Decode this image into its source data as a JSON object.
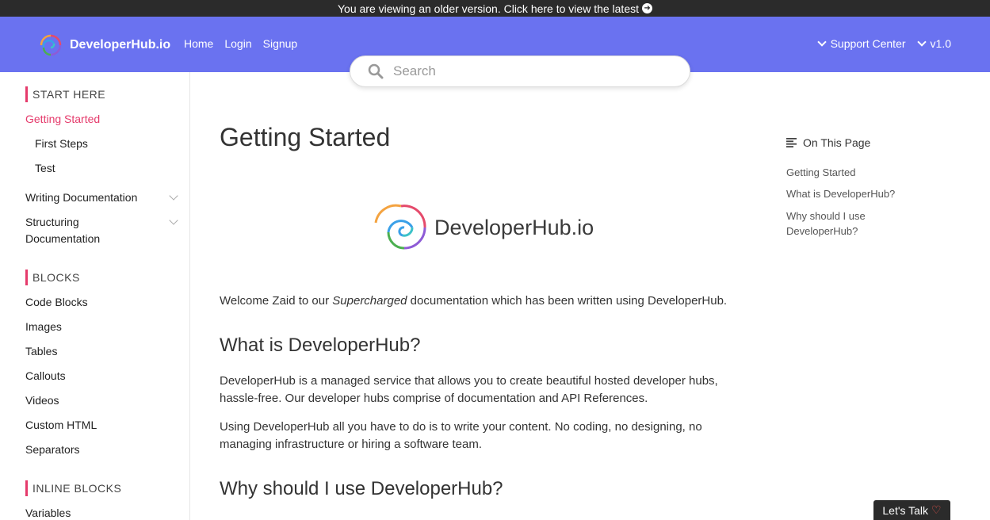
{
  "topbar": {
    "text": "You are viewing an older version. Click here to view the latest"
  },
  "header": {
    "brand": "DeveloperHub.io",
    "nav": [
      "Home",
      "Login",
      "Signup"
    ],
    "support": "Support Center",
    "version": "v1.0"
  },
  "search": {
    "placeholder": "Search"
  },
  "sidebar": {
    "start_here": "START HERE",
    "getting_started": "Getting Started",
    "first_steps": "First Steps",
    "test": "Test",
    "writing_docs": "Writing Documentation",
    "structuring_1": "Structuring",
    "structuring_2": "Documentation",
    "blocks": "BLOCKS",
    "code_blocks": "Code Blocks",
    "images": "Images",
    "tables": "Tables",
    "callouts": "Callouts",
    "videos": "Videos",
    "custom_html": "Custom HTML",
    "separators": "Separators",
    "inline_blocks": "INLINE BLOCKS",
    "variables": "Variables"
  },
  "main": {
    "title": "Getting Started",
    "logo_text": "DeveloperHub.io",
    "welcome_pre": "Welcome Zaid to our ",
    "welcome_em": "Supercharged",
    "welcome_post": " documentation which has been written using DeveloperHub.",
    "h_what": "What is DeveloperHub?",
    "p_what_1": "DeveloperHub is a managed service that allows you to create beautiful hosted developer hubs, hassle-free. Our developer hubs comprise of documentation and API References.",
    "p_what_2": "Using DeveloperHub all you have to do is to write your content. No coding, no designing, no managing infrastructure or hiring a software team.",
    "h_why": "Why should I use DeveloperHub?"
  },
  "toc": {
    "title": "On This Page",
    "links": [
      "Getting Started",
      "What is DeveloperHub?",
      "Why should I use DeveloperHub?"
    ]
  },
  "chat": {
    "label": "Let's Talk"
  },
  "colors": {
    "header": "#6a72f0",
    "accent": "#e53a6b",
    "dark": "#2b2b2b"
  }
}
